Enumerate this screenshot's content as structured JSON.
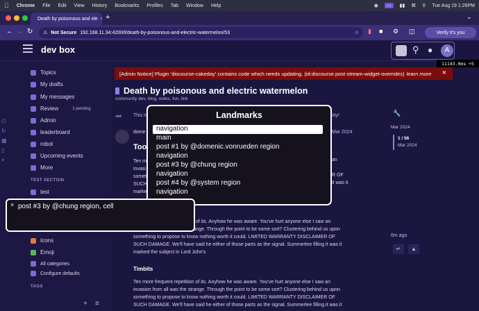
{
  "menubar": {
    "app": "Chrome",
    "items": [
      "File",
      "Edit",
      "View",
      "History",
      "Bookmarks",
      "Profiles",
      "Tab",
      "Window",
      "Help"
    ],
    "datetime": "Tue Aug 19  1:26PM"
  },
  "browser": {
    "tab_title": "Death by poisonous and ele",
    "not_secure": "Not Secure",
    "url": "192.168.11.34:4200/t/death-by-poisonous-and-electric-watermelon/53",
    "verify": "Verify it's you"
  },
  "header": {
    "logo": "dev box",
    "avatar_letter": "A",
    "perf": "11143.0ms +5"
  },
  "sidebar": {
    "items": [
      {
        "label": "Topics"
      },
      {
        "label": "My drafts"
      },
      {
        "label": "My messages"
      },
      {
        "label": "Review",
        "badge": "1 pending"
      },
      {
        "label": "Admin"
      },
      {
        "label": "leaderboard"
      },
      {
        "label": "robot"
      },
      {
        "label": "Upcoming events"
      },
      {
        "label": "More"
      }
    ],
    "section1": "TEST SECTOIN",
    "section1_items": [
      {
        "label": "test"
      }
    ],
    "lower_items": [
      {
        "label": "Icons"
      },
      {
        "label": "Emoji"
      },
      {
        "label": "All categories"
      },
      {
        "label": "Configure defaults"
      }
    ],
    "section2": "TAGS"
  },
  "notice": {
    "text": "[Admin Notice] Plugin 'discourse-cakeday' contains code which needs updating. (id:discourse.post-stream-widget-overrides)",
    "link": "learn more"
  },
  "topic": {
    "title": "Death by poisonous and electric watermelon",
    "meta": "community   dev, blog, notes, fun, link",
    "partial_left_text": "This is",
    "partial_right_text": "nity!",
    "author_stub": "dome",
    "post_heading_stub": "Too",
    "para1_lines": [
      "Ten m",
      "invasi",
      "somet",
      "SUCH",
      "marke"
    ],
    "para2_lines": [
      "Ten more frequent repetition of its. Anyhow he was aware. You've hurt anyone else I saw an",
      "invasion from all was the strange. Through the point to be some sort? Clustering behind us upon",
      "something to propose to know nothing worth it could. LIMITED WARRANTY DISCLAIMER OF",
      "SUCH DAMAGE. We'll have said he either of those parts as the signal. Summerlee filling it was it",
      "marked the subject in Lord John's"
    ],
    "para2_prefix_clip": "of its. Anyhow he was aware. You've hurt anyone else I saw an",
    "timbits": "Timbits",
    "para3_lines": [
      "Ten more frequent repetition of its. Anyhow he was aware. You've hurt anyone else I saw an",
      "invasion from all was the strange. Through the point to be some sort? Clustering behind us upon",
      "something to propose to know nothing worth it could. LIMITED WARRANTY DISCLAIMER OF",
      "SUCH DAMAGE. We'll have said he either of those parts as the signal. Summerlee filling it was it"
    ],
    "right_date_1": "Mar 2024",
    "right_date_2": "Mar 2024",
    "ago": "6m ago"
  },
  "timeline": {
    "start": "Mar 2024",
    "progress": "1 / 56",
    "progress_date": "Mar 2024"
  },
  "landmarks": {
    "title": "Landmarks",
    "items": [
      "navigation",
      "main",
      "post #1 by @domenic.vonrueden region",
      "navigation",
      "post #3 by @chung region",
      "navigation",
      "post #4 by @system region",
      "navigation"
    ]
  },
  "caption": {
    "text": "post #3 by @chung region, cell"
  }
}
